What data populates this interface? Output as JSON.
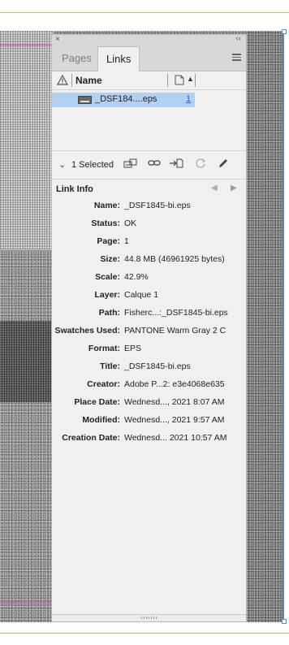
{
  "panel": {
    "tabs": [
      {
        "label": "Pages",
        "active": false
      },
      {
        "label": "Links",
        "active": true
      }
    ],
    "columns": {
      "name_label": "Name"
    }
  },
  "links": [
    {
      "name": "_DSF184....eps",
      "page": "1",
      "selected": true
    }
  ],
  "toolbar": {
    "selected_count_label": "1 Selected"
  },
  "link_info": {
    "title": "Link Info",
    "fields": [
      {
        "label": "Name:",
        "value": "_DSF1845-bi.eps"
      },
      {
        "label": "Status:",
        "value": "OK"
      },
      {
        "label": "Page:",
        "value": "1"
      },
      {
        "label": "Size:",
        "value": "44.8 MB (46961925 bytes)"
      },
      {
        "label": "Scale:",
        "value": "42.9%"
      },
      {
        "label": "Layer:",
        "value": "Calque 1"
      },
      {
        "label": "Path:",
        "value": "Fisherc...:_DSF1845-bi.eps"
      },
      {
        "label": "Swatches Used:",
        "value": "PANTONE Warm Gray 2 C"
      },
      {
        "label": "Format:",
        "value": "EPS"
      },
      {
        "label": "Title:",
        "value": "_DSF1845-bi.eps"
      },
      {
        "label": "Creator:",
        "value": "Adobe P...2: e3e4068e635"
      },
      {
        "label": "Place Date:",
        "value": "Wednesd..., 2021 8:07 AM"
      },
      {
        "label": "Modified:",
        "value": "Wednesd..., 2021 9:57 AM"
      },
      {
        "label": "Creation Date:",
        "value": "Wednesd... 2021 10:57 AM"
      }
    ]
  },
  "colors": {
    "selection": "#b4d0f0",
    "link_blue": "#2a62c8",
    "panel_bg": "#f0f0f0"
  }
}
